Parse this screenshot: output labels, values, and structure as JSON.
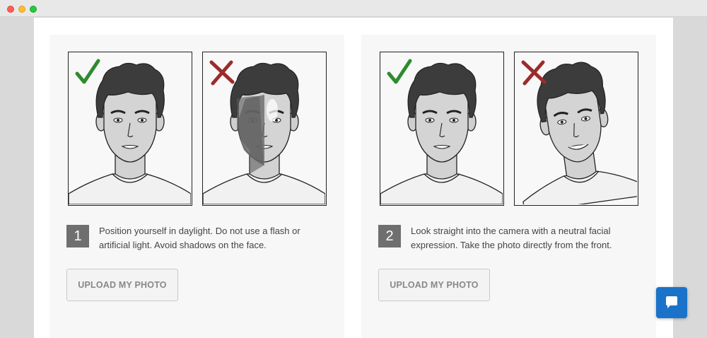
{
  "window": {
    "controls": [
      "close",
      "minimize",
      "maximize"
    ]
  },
  "cards": [
    {
      "step_number": "1",
      "instruction": "Position yourself in daylight. Do not use a flash or artificial light. Avoid shadows on the face.",
      "upload_label": "UPLOAD MY PHOTO",
      "good_example": {
        "mark": "check-icon",
        "variant": "neutral-face"
      },
      "bad_example": {
        "mark": "cross-icon",
        "variant": "shadowed-face"
      }
    },
    {
      "step_number": "2",
      "instruction": "Look straight into the camera with a neutral facial expression. Take the photo directly from the front.",
      "upload_label": "UPLOAD MY PHOTO",
      "good_example": {
        "mark": "check-icon",
        "variant": "neutral-face"
      },
      "bad_example": {
        "mark": "cross-icon",
        "variant": "tilted-smiling-face"
      }
    }
  ],
  "chat_button": {
    "icon": "chat-bubble-icon",
    "color": "#1a73c9"
  },
  "colors": {
    "check": "#2e8b2e",
    "cross": "#9b2c2c",
    "step_badge": "#6f6f6f"
  }
}
